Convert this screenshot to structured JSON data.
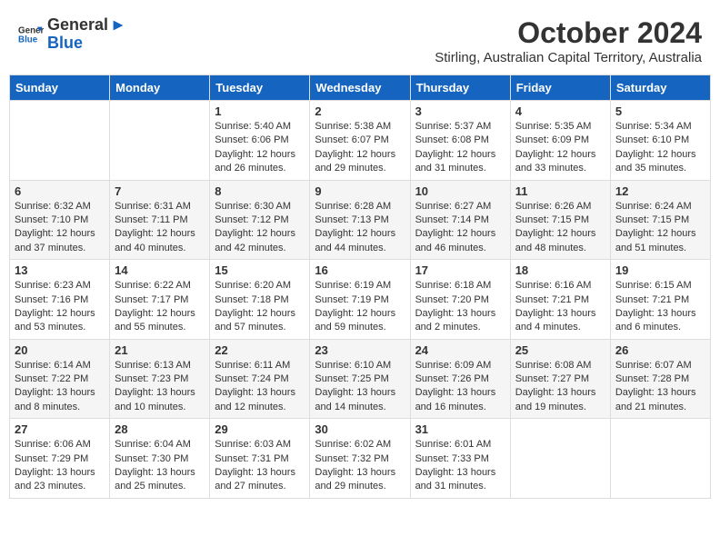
{
  "header": {
    "logo_general": "General",
    "logo_blue": "Blue",
    "month_title": "October 2024",
    "subtitle": "Stirling, Australian Capital Territory, Australia"
  },
  "days_of_week": [
    "Sunday",
    "Monday",
    "Tuesday",
    "Wednesday",
    "Thursday",
    "Friday",
    "Saturday"
  ],
  "weeks": [
    [
      {
        "day": "",
        "info": ""
      },
      {
        "day": "",
        "info": ""
      },
      {
        "day": "1",
        "info": "Sunrise: 5:40 AM\nSunset: 6:06 PM\nDaylight: 12 hours\nand 26 minutes."
      },
      {
        "day": "2",
        "info": "Sunrise: 5:38 AM\nSunset: 6:07 PM\nDaylight: 12 hours\nand 29 minutes."
      },
      {
        "day": "3",
        "info": "Sunrise: 5:37 AM\nSunset: 6:08 PM\nDaylight: 12 hours\nand 31 minutes."
      },
      {
        "day": "4",
        "info": "Sunrise: 5:35 AM\nSunset: 6:09 PM\nDaylight: 12 hours\nand 33 minutes."
      },
      {
        "day": "5",
        "info": "Sunrise: 5:34 AM\nSunset: 6:10 PM\nDaylight: 12 hours\nand 35 minutes."
      }
    ],
    [
      {
        "day": "6",
        "info": "Sunrise: 6:32 AM\nSunset: 7:10 PM\nDaylight: 12 hours\nand 37 minutes."
      },
      {
        "day": "7",
        "info": "Sunrise: 6:31 AM\nSunset: 7:11 PM\nDaylight: 12 hours\nand 40 minutes."
      },
      {
        "day": "8",
        "info": "Sunrise: 6:30 AM\nSunset: 7:12 PM\nDaylight: 12 hours\nand 42 minutes."
      },
      {
        "day": "9",
        "info": "Sunrise: 6:28 AM\nSunset: 7:13 PM\nDaylight: 12 hours\nand 44 minutes."
      },
      {
        "day": "10",
        "info": "Sunrise: 6:27 AM\nSunset: 7:14 PM\nDaylight: 12 hours\nand 46 minutes."
      },
      {
        "day": "11",
        "info": "Sunrise: 6:26 AM\nSunset: 7:15 PM\nDaylight: 12 hours\nand 48 minutes."
      },
      {
        "day": "12",
        "info": "Sunrise: 6:24 AM\nSunset: 7:15 PM\nDaylight: 12 hours\nand 51 minutes."
      }
    ],
    [
      {
        "day": "13",
        "info": "Sunrise: 6:23 AM\nSunset: 7:16 PM\nDaylight: 12 hours\nand 53 minutes."
      },
      {
        "day": "14",
        "info": "Sunrise: 6:22 AM\nSunset: 7:17 PM\nDaylight: 12 hours\nand 55 minutes."
      },
      {
        "day": "15",
        "info": "Sunrise: 6:20 AM\nSunset: 7:18 PM\nDaylight: 12 hours\nand 57 minutes."
      },
      {
        "day": "16",
        "info": "Sunrise: 6:19 AM\nSunset: 7:19 PM\nDaylight: 12 hours\nand 59 minutes."
      },
      {
        "day": "17",
        "info": "Sunrise: 6:18 AM\nSunset: 7:20 PM\nDaylight: 13 hours\nand 2 minutes."
      },
      {
        "day": "18",
        "info": "Sunrise: 6:16 AM\nSunset: 7:21 PM\nDaylight: 13 hours\nand 4 minutes."
      },
      {
        "day": "19",
        "info": "Sunrise: 6:15 AM\nSunset: 7:21 PM\nDaylight: 13 hours\nand 6 minutes."
      }
    ],
    [
      {
        "day": "20",
        "info": "Sunrise: 6:14 AM\nSunset: 7:22 PM\nDaylight: 13 hours\nand 8 minutes."
      },
      {
        "day": "21",
        "info": "Sunrise: 6:13 AM\nSunset: 7:23 PM\nDaylight: 13 hours\nand 10 minutes."
      },
      {
        "day": "22",
        "info": "Sunrise: 6:11 AM\nSunset: 7:24 PM\nDaylight: 13 hours\nand 12 minutes."
      },
      {
        "day": "23",
        "info": "Sunrise: 6:10 AM\nSunset: 7:25 PM\nDaylight: 13 hours\nand 14 minutes."
      },
      {
        "day": "24",
        "info": "Sunrise: 6:09 AM\nSunset: 7:26 PM\nDaylight: 13 hours\nand 16 minutes."
      },
      {
        "day": "25",
        "info": "Sunrise: 6:08 AM\nSunset: 7:27 PM\nDaylight: 13 hours\nand 19 minutes."
      },
      {
        "day": "26",
        "info": "Sunrise: 6:07 AM\nSunset: 7:28 PM\nDaylight: 13 hours\nand 21 minutes."
      }
    ],
    [
      {
        "day": "27",
        "info": "Sunrise: 6:06 AM\nSunset: 7:29 PM\nDaylight: 13 hours\nand 23 minutes."
      },
      {
        "day": "28",
        "info": "Sunrise: 6:04 AM\nSunset: 7:30 PM\nDaylight: 13 hours\nand 25 minutes."
      },
      {
        "day": "29",
        "info": "Sunrise: 6:03 AM\nSunset: 7:31 PM\nDaylight: 13 hours\nand 27 minutes."
      },
      {
        "day": "30",
        "info": "Sunrise: 6:02 AM\nSunset: 7:32 PM\nDaylight: 13 hours\nand 29 minutes."
      },
      {
        "day": "31",
        "info": "Sunrise: 6:01 AM\nSunset: 7:33 PM\nDaylight: 13 hours\nand 31 minutes."
      },
      {
        "day": "",
        "info": ""
      },
      {
        "day": "",
        "info": ""
      }
    ]
  ]
}
